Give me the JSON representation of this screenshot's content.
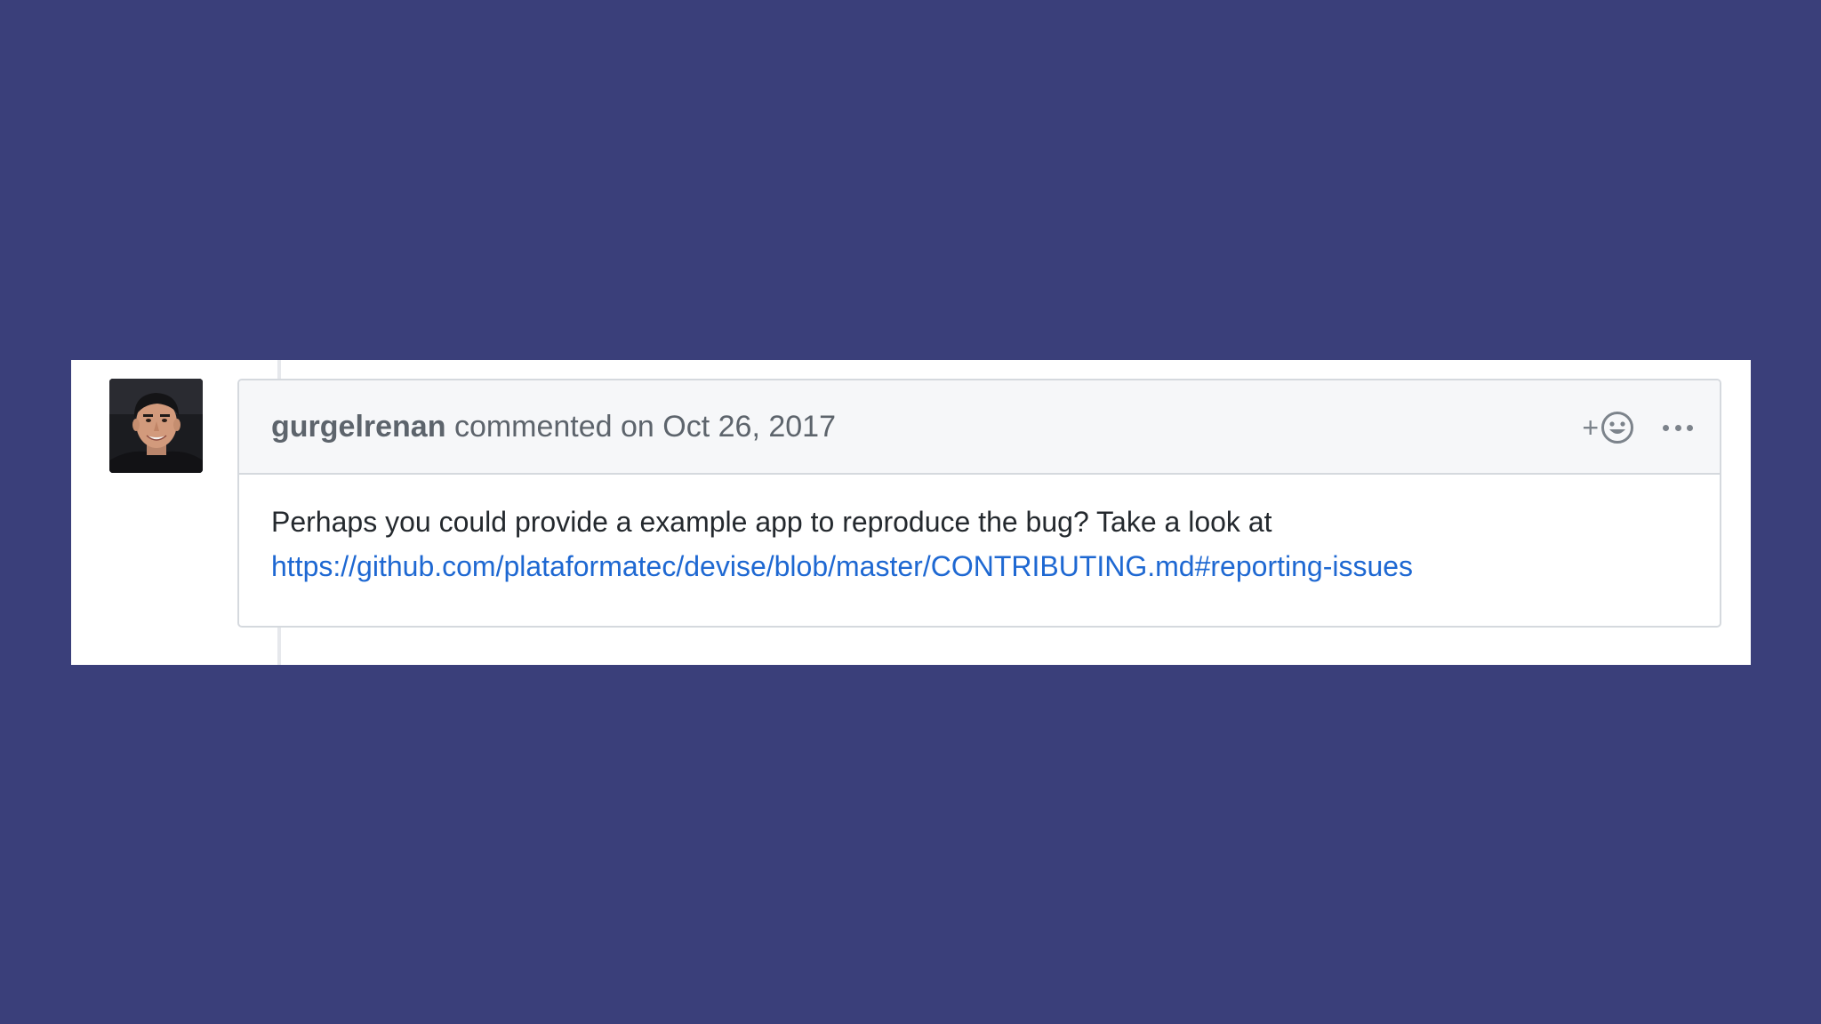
{
  "comment": {
    "author": "gurgelrenan",
    "action": "commented on",
    "date": "Oct 26, 2017",
    "body_text": "Perhaps you could provide a example app to reproduce the bug? Take a look at",
    "link_text": "https://github.com/plataformatec/devise/blob/master/CONTRIBUTING.md#reporting-issues",
    "avatar": "user-photo"
  },
  "actions": {
    "add_reaction_plus": "+",
    "add_reaction_icon": "smiley-icon",
    "more_icon": "kebab-horizontal-icon"
  },
  "colors": {
    "background": "#3a3f7a",
    "panel": "#ffffff",
    "header_bg": "#f6f7f9",
    "border": "#d5d9de",
    "link": "#1e68d2",
    "muted_text": "#5d646c"
  }
}
